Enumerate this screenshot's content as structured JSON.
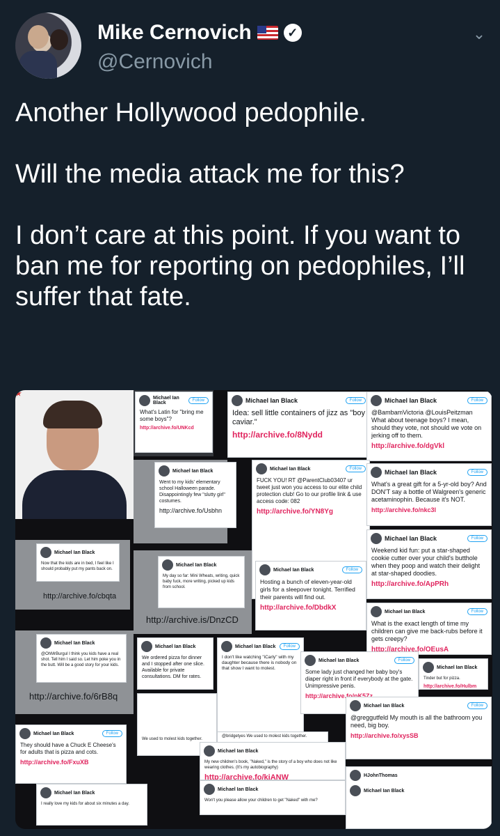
{
  "author": {
    "name": "Mike Cernovich",
    "handle": "@Cernovich"
  },
  "icons": [
    "us-flag-icon",
    "verified-badge-icon",
    "chevron-down-icon"
  ],
  "tweet": {
    "paragraphs": [
      "Another Hollywood pedophile.",
      "Will the media attack me for this?",
      "I don’t care at this point. If you want to ban me for reporting on pedophiles, I’ll suffer that fate."
    ]
  },
  "collage": {
    "account_name": "Michael Ian Black",
    "follow_label": "Follow",
    "cards": [
      {
        "text": "What's Latin for \"bring me some boys\"?",
        "link": "http://archive.fo/UNKcd"
      },
      {
        "text": "Idea: sell little containers of jizz as \"boy caviar.\"",
        "link": "http://archive.fo/8Nydd"
      },
      {
        "text": "@BambamVictoria @LouisPeitzman What about teenage boys? I mean, should they vote, not should we vote on jerking off to them.",
        "link": "http://archive.fo/dgVkl"
      },
      {
        "text": "Went to my kids' elementary school Halloween parade. Disappointingly few \"slutty girl\" costumes.",
        "link": "http://archive.fo/Usbhn"
      },
      {
        "text": "FUCK YOU! RT @ParentClub03407 ur tweet just won you access to our elite child protection club! Go to our profile link & use access code: 082",
        "link": "http://archive.fo/YN8Yg"
      },
      {
        "text": "What's a great gift for a 5-yr-old boy? And DON'T say a bottle of Walgreen's generic acetaminophin. Because it's NOT.",
        "link": "http://archive.fo/nkc3l"
      },
      {
        "text": "Now that the kids are in bed, I feel like I should probably put my pants back on.",
        "link": "http://archive.fo/cbqta"
      },
      {
        "text": "My day so far: Mini Wheats, writing, quick baby fuck, more writing, picked up kids from school.",
        "link": "http://archive.is/DnzCD"
      },
      {
        "text": "Hosting a bunch of eleven-year-old girls for a sleepover tonight. Terrified their parents will find out.",
        "link": "http://archive.fo/DbdkX"
      },
      {
        "text": "Weekend kid fun: put a star-shaped cookie cutter over your child's butthole when they poop and watch their delight at star-shaped doodies.",
        "link": "http://archive.fo/ApPRh"
      },
      {
        "text": "What is the exact length of time my children can give me back-rubs before it gets creepy?",
        "link": "http://archive.fo/OEusA"
      },
      {
        "text": "@OhMrBurgul I think you kids have a real shot. Tell him I said so. Let him poke you in the butt. Will be a good story for your kids.",
        "link": "http://archive.fo/6rB8q"
      },
      {
        "text": "We ordered pizza for dinner and I stopped after one slice. Available for private consultations. DM for rates.",
        "link": ""
      },
      {
        "text": "I don't like watching \"iCarly\" with my daughter because there is nobody on that show I want to molest.",
        "link": ""
      },
      {
        "text": "Some lady just changed her baby boy's diaper right in front if everybody at the gate. Unimpressive penis.",
        "link": "http://archive.fo/pK5Zz"
      },
      {
        "text": "Tinder but for pizza.",
        "link": "http://archive.fo/Hulbm"
      },
      {
        "text": "@greggutfeld My mouth is all the bathroom you need, big boy.",
        "link": "http://archive.fo/xysSB"
      },
      {
        "text": "They should have a Chuck E Cheese's for adults that is pizza and cots.",
        "link": "http://archive.fo/FxuXB"
      },
      {
        "text": "@bridgetyes We used to molest kids together.",
        "link": ""
      },
      {
        "text": "My new children's book, \"Naked,\" is the story of a boy who does not like wearing clothes. (It's my autobiography)",
        "link": "http://archive.fo/kiANW"
      },
      {
        "text": "Won't you please allow your children to get \"Naked\" with me?",
        "link": ""
      },
      {
        "text": "I really love my kids for about six minutes a day.",
        "link": ""
      },
      {
        "text": "We used to molest kids together.",
        "link": ""
      }
    ]
  }
}
